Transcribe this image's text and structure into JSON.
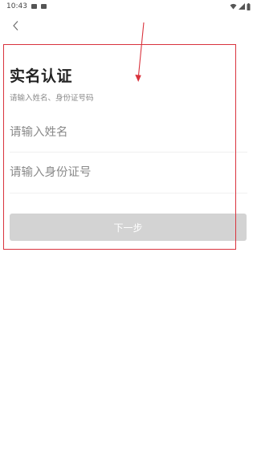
{
  "status_bar": {
    "time": "10:43",
    "left_icons": [
      "image-icon",
      "notification-icon"
    ],
    "right_icons": [
      "wifi-icon",
      "signal-icon",
      "battery-icon"
    ]
  },
  "nav": {
    "back_icon": "chevron-left-icon"
  },
  "page": {
    "title": "实名认证",
    "subtitle": "请输入姓名、身份证号码"
  },
  "form": {
    "name_placeholder": "请输入姓名",
    "name_value": "",
    "id_placeholder": "请输入身份证号",
    "id_value": "",
    "next_label": "下一步"
  },
  "colors": {
    "annotation": "#d9333d",
    "button_disabled": "#d3d3d3"
  }
}
